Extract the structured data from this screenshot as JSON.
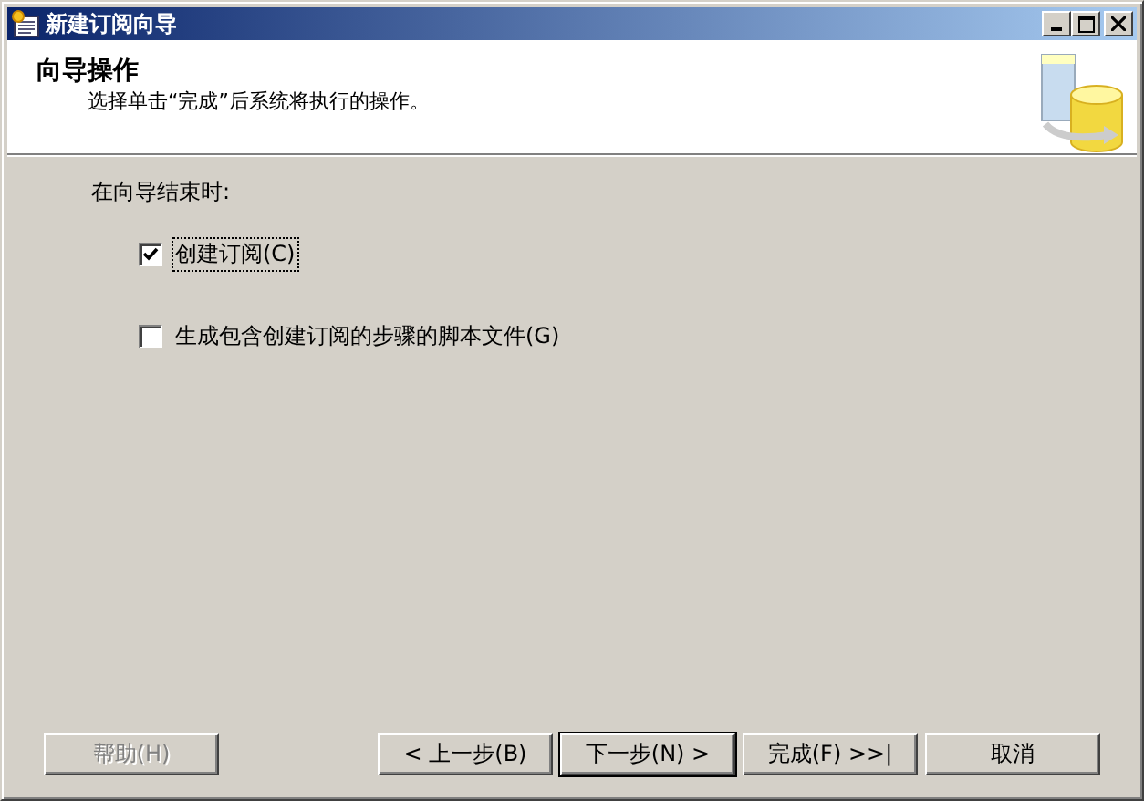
{
  "window": {
    "title": "新建订阅向导"
  },
  "header": {
    "title": "向导操作",
    "subtitle": "选择单击“完成”后系统将执行的操作。"
  },
  "prompt": "在向导结束时:",
  "options": [
    {
      "label": "创建订阅(C)",
      "checked": true,
      "focused": true
    },
    {
      "label": "生成包含创建订阅的步骤的脚本文件(G)",
      "checked": false,
      "focused": false
    }
  ],
  "buttons": [
    {
      "label": "帮助(H)",
      "disabled": true,
      "default": false
    },
    {
      "label": "< 上一步(B)",
      "disabled": false,
      "default": false
    },
    {
      "label": "下一步(N) >",
      "disabled": false,
      "default": true
    },
    {
      "label": "完成(F) >>|",
      "disabled": false,
      "default": false
    },
    {
      "label": "取消",
      "disabled": false,
      "default": false
    }
  ]
}
